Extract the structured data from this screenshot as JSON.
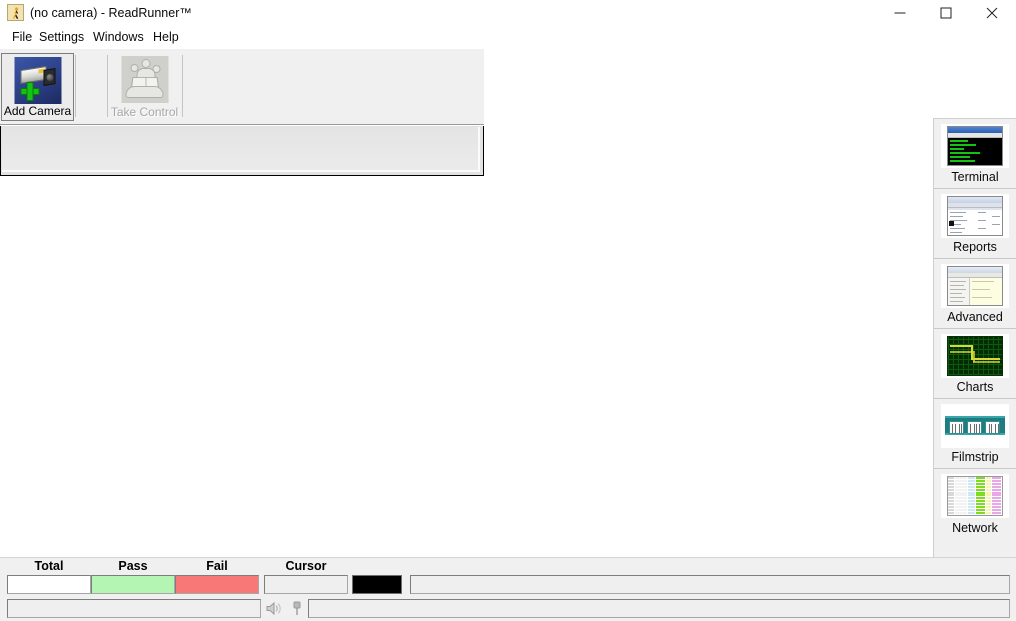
{
  "window": {
    "title": "(no camera) - ReadRunner™",
    "icon": "readrunner-app-icon",
    "controls": {
      "minimize": "minimize-button",
      "maximize": "maximize-button",
      "close": "close-button"
    }
  },
  "menu": {
    "items": [
      {
        "label": "File"
      },
      {
        "label": "Settings"
      },
      {
        "label": "Windows"
      },
      {
        "label": "Help"
      }
    ]
  },
  "toolbar": {
    "buttons": [
      {
        "label": "Add Camera",
        "icon": "add-camera-icon",
        "enabled": true
      },
      {
        "label": "Take Control",
        "icon": "take-control-icon",
        "enabled": false
      }
    ]
  },
  "sidebar": {
    "items": [
      {
        "label": "Terminal",
        "icon": "terminal-thumbnail"
      },
      {
        "label": "Reports",
        "icon": "reports-thumbnail"
      },
      {
        "label": "Advanced",
        "icon": "advanced-thumbnail"
      },
      {
        "label": "Charts",
        "icon": "charts-thumbnail"
      },
      {
        "label": "Filmstrip",
        "icon": "filmstrip-thumbnail"
      },
      {
        "label": "Network",
        "icon": "network-thumbnail"
      }
    ]
  },
  "statusbar": {
    "headers": {
      "total": "Total",
      "pass": "Pass",
      "fail": "Fail",
      "cursor": "Cursor"
    },
    "fields": {
      "total_value": "",
      "pass_value": "",
      "fail_value": "",
      "cursor_value": "",
      "message_value": "",
      "log_value": "",
      "info_value": ""
    },
    "colors": {
      "total_bg": "#ffffff",
      "pass_bg": "#b4f5b4",
      "fail_bg": "#f87878",
      "cursor_bg": "#efefef",
      "swatch": "#000000"
    },
    "icons": [
      {
        "name": "speaker-mute-icon"
      },
      {
        "name": "marker-pin-icon"
      }
    ]
  }
}
